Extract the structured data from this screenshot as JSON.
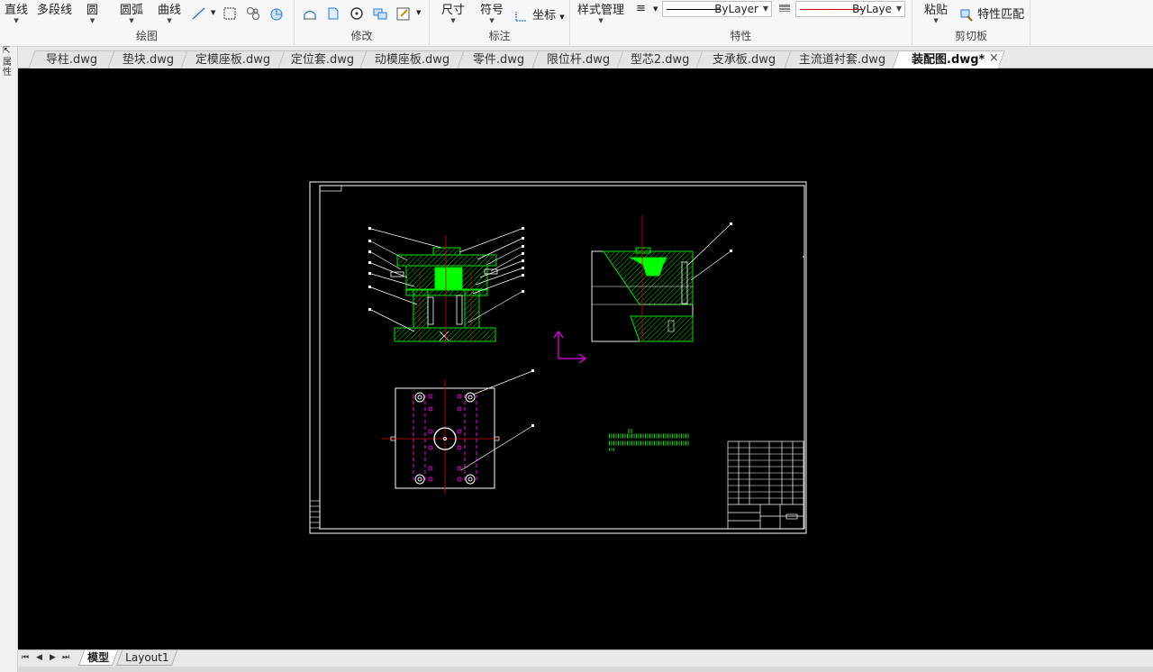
{
  "ribbon": {
    "draw": {
      "title": "绘图",
      "line": "直线",
      "polyline": "多段线",
      "circle": "圆",
      "arc": "圆弧",
      "curve": "曲线"
    },
    "modify": {
      "title": "修改"
    },
    "annotate": {
      "title": "标注",
      "dimension": "尺寸",
      "symbol": "符号",
      "coordinate": "坐标"
    },
    "properties": {
      "title": "特性",
      "style_manager": "样式管理",
      "linetype_value": "ByLayer",
      "color_value": "ByLaye",
      "linetype_color": "#000000",
      "color_line_color": "#d40000"
    },
    "clipboard": {
      "title": "剪切板",
      "paste": "粘贴",
      "match_properties": "特性匹配"
    }
  },
  "left_strip": {
    "text": "属性"
  },
  "tabs": [
    {
      "label": "导柱.dwg",
      "active": false
    },
    {
      "label": "垫块.dwg",
      "active": false
    },
    {
      "label": "定模座板.dwg",
      "active": false
    },
    {
      "label": "定位套.dwg",
      "active": false
    },
    {
      "label": "动模座板.dwg",
      "active": false
    },
    {
      "label": "零件.dwg",
      "active": false
    },
    {
      "label": "限位杆.dwg",
      "active": false
    },
    {
      "label": "型芯2.dwg",
      "active": false
    },
    {
      "label": "支承板.dwg",
      "active": false
    },
    {
      "label": "主流道衬套.dwg",
      "active": false
    },
    {
      "label": "装配图.dwg*",
      "active": true
    }
  ],
  "tab_close": "×",
  "layout_tabs": [
    {
      "label": "模型",
      "active": true
    },
    {
      "label": "Layout1",
      "active": false
    }
  ],
  "colors": {
    "canvas": "#000000",
    "drawing_green": "#00e000",
    "drawing_red": "#e00000",
    "drawing_magenta": "#e000e0",
    "drawing_white": "#ffffff"
  }
}
